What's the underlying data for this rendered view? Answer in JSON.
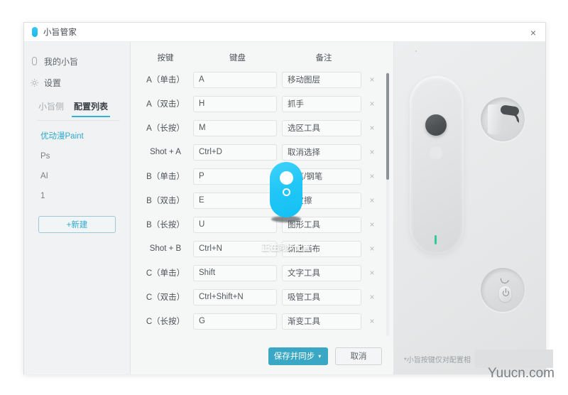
{
  "window": {
    "title": "小旨管家",
    "close_label": "×"
  },
  "sidebar": {
    "nav": [
      {
        "label": "我的小旨",
        "icon": "device-icon"
      },
      {
        "label": "设置",
        "icon": "gear-icon"
      }
    ],
    "tabs": [
      {
        "label": "小旨侧",
        "active": false
      },
      {
        "label": "配置列表",
        "active": true
      }
    ],
    "configs": [
      {
        "label": "优动漫Paint",
        "active": true
      },
      {
        "label": "Ps",
        "active": false
      },
      {
        "label": "AI",
        "active": false
      },
      {
        "label": "1",
        "active": false
      }
    ],
    "new_button": "+新建"
  },
  "table": {
    "headers": [
      "按键",
      "键盘",
      "备注"
    ],
    "delete_glyph": "×",
    "rows": [
      {
        "key": "A（单击）",
        "keyboard": "A",
        "remark": "移动图层"
      },
      {
        "key": "A（双击）",
        "keyboard": "H",
        "remark": "抓手"
      },
      {
        "key": "A（长按）",
        "keyboard": "M",
        "remark": "选区工具"
      },
      {
        "key": "Shot + A",
        "keyboard": "Ctrl+D",
        "remark": "取消选择"
      },
      {
        "key": "B（单击）",
        "keyboard": "P",
        "remark": "画笔/钢笔"
      },
      {
        "key": "B（双击）",
        "keyboard": "E",
        "remark": "橡皮擦"
      },
      {
        "key": "B（长按）",
        "keyboard": "U",
        "remark": "图形工具"
      },
      {
        "key": "Shot + B",
        "keyboard": "Ctrl+N",
        "remark": "新建画布"
      },
      {
        "key": "C（单击）",
        "keyboard": "Shift",
        "remark": "文字工具"
      },
      {
        "key": "C（双击）",
        "keyboard": "Ctrl+Shift+N",
        "remark": "吸管工具"
      },
      {
        "key": "C（长按）",
        "keyboard": "G",
        "remark": "渐变工具"
      }
    ]
  },
  "footer": {
    "save_label": "保存并同步",
    "save_caret": "▾",
    "cancel_label": "取消"
  },
  "device_panel": {
    "note": "*小旨按键仅对配置相"
  },
  "sync": {
    "status_text": "正在同步配置"
  },
  "watermark": {
    "text": "Yuucn.com"
  },
  "colors": {
    "accent_blue": "#2fb4d9",
    "sync_cyan": "#22c7f6",
    "primary_button": "#3aa8c4",
    "led_green": "#35c99a",
    "config_active": "#2ea9cf"
  }
}
